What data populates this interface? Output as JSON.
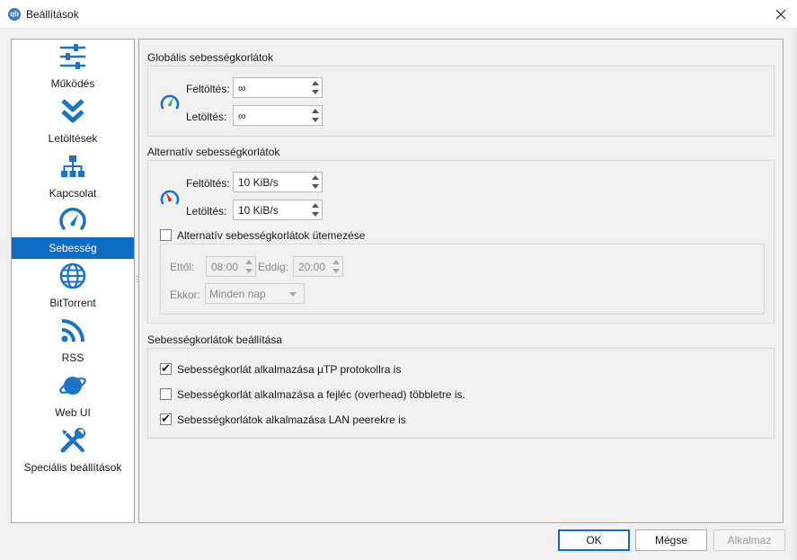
{
  "window": {
    "title": "Beállítások",
    "app_icon_text": "qb"
  },
  "sidebar": {
    "items": [
      {
        "label": "Működés",
        "icon": "sliders-icon"
      },
      {
        "label": "Letöltések",
        "icon": "double-chevron-down-icon"
      },
      {
        "label": "Kapcsolat",
        "icon": "network-icon"
      },
      {
        "label": "Sebesség",
        "icon": "speedometer-icon",
        "selected": true
      },
      {
        "label": "BitTorrent",
        "icon": "globe-icon"
      },
      {
        "label": "RSS",
        "icon": "rss-icon"
      },
      {
        "label": "Web UI",
        "icon": "planet-icon"
      },
      {
        "label": "Speciális beállítások",
        "icon": "tools-icon"
      }
    ]
  },
  "global_limits": {
    "title": "Globális sebességkorlátok",
    "upload_label": "Feltöltés:",
    "upload_value": "∞",
    "download_label": "Letöltés:",
    "download_value": "∞"
  },
  "alt_limits": {
    "title": "Alternatív sebességkorlátok",
    "upload_label": "Feltöltés:",
    "upload_value": "10 KiB/s",
    "download_label": "Letöltés:",
    "download_value": "10 KiB/s",
    "schedule_label": "Alternatív sebességkorlátok ütemezése",
    "schedule_checked": false,
    "from_label": "Ettől:",
    "from_value": "08:00",
    "to_label": "Eddig:",
    "to_value": "20:00",
    "when_label": "Ekkor:",
    "when_value": "Minden nap"
  },
  "limit_settings": {
    "title": "Sebességkorlátok beállítása",
    "options": [
      {
        "label": "Sebességkorlát alkalmazása µTP protokollra is",
        "checked": true
      },
      {
        "label": "Sebességkorlát alkalmazása a fejléc (overhead) többletre is.",
        "checked": false
      },
      {
        "label": "Sebességkorlátok alkalmazása LAN peerekre is",
        "checked": true
      }
    ]
  },
  "buttons": {
    "ok": "OK",
    "cancel": "Mégse",
    "apply": "Alkalmaz"
  },
  "colors": {
    "accent": "#0f6cc4",
    "icon_blue": "#1a73c9",
    "gauge_green": "#2db34a",
    "gauge_red": "#e0202b"
  }
}
